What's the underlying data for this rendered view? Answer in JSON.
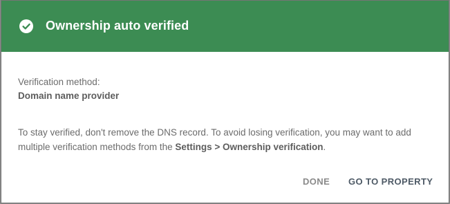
{
  "dialog": {
    "title": "Ownership auto verified",
    "header_color": "#3c8c53",
    "icon": "check-circle-icon",
    "method_label": "Verification method:",
    "method_value": "Domain name provider",
    "info_prefix": "To stay verified, don't remove the DNS record. To avoid losing verification, you may want to add multiple verification methods from the ",
    "info_bold": "Settings > Ownership verification",
    "info_suffix": ".",
    "buttons": {
      "done": "DONE",
      "go_to_property": "GO TO PROPERTY"
    }
  }
}
